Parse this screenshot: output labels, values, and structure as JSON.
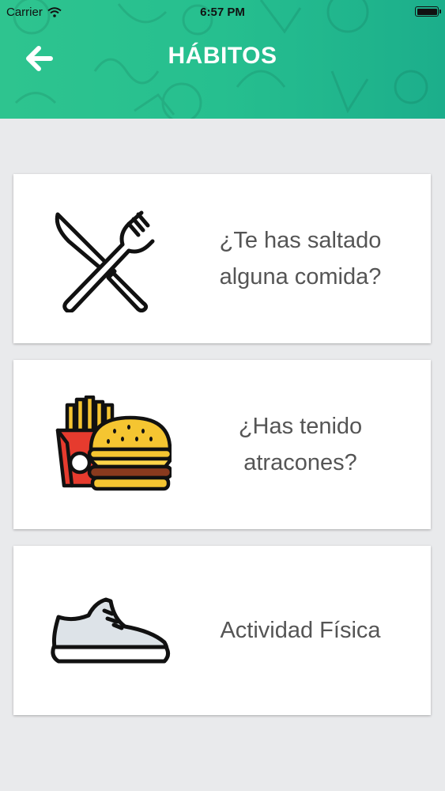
{
  "status_bar": {
    "carrier": "Carrier",
    "time": "6:57 PM"
  },
  "header": {
    "title": "HÁBITOS",
    "back_icon": "arrow-left-icon",
    "color_start": "#2ec48f",
    "color_end": "#1cae8b"
  },
  "cards": [
    {
      "icon": "knife-fork-icon",
      "label": "¿Te has saltado\nalguna comida?"
    },
    {
      "icon": "burger-fries-icon",
      "label": "¿Has tenido\natracones?"
    },
    {
      "icon": "sneaker-icon",
      "label": "Actividad Física"
    }
  ],
  "colors": {
    "background": "#e9eaec",
    "card": "#ffffff",
    "text": "#555555"
  }
}
